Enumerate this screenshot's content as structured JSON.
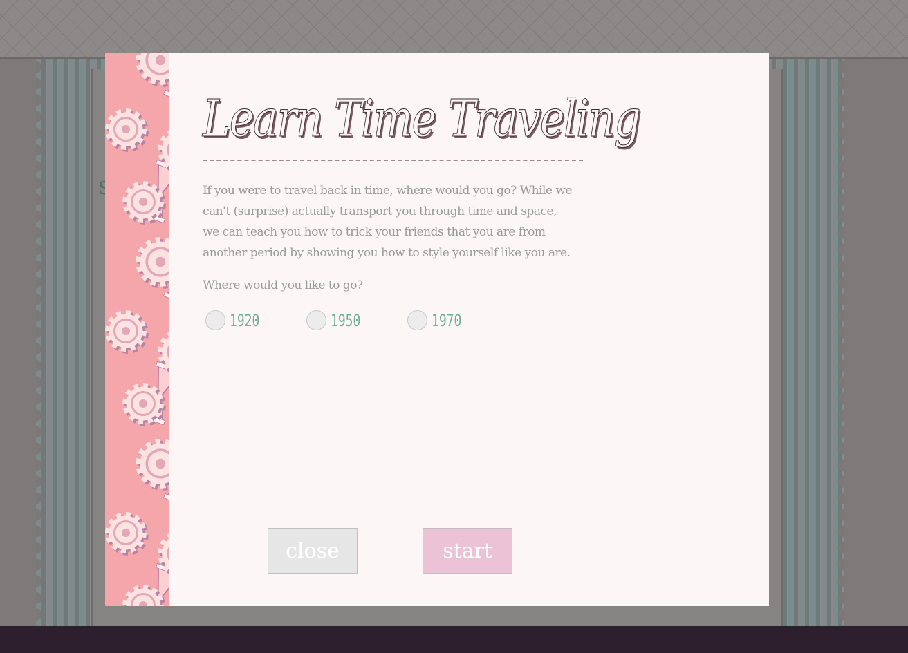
{
  "background": {
    "ghost_text": "S"
  },
  "modal": {
    "title": "Learn Time Traveling",
    "description": "If you were to travel back in time, where would you go? While we can't (surprise) actually transport you through time and space, we can teach you how to trick your friends that you are from another period by showing you how to style yourself like you are.",
    "question": "Where would you like to go?",
    "options": [
      {
        "label": "1920",
        "selected": false
      },
      {
        "label": "1950",
        "selected": false
      },
      {
        "label": "1970",
        "selected": false
      }
    ],
    "close_label": "close",
    "start_label": "start"
  },
  "colors": {
    "modal_bg": "#fdf6f7",
    "art_pink": "#f4a6ab",
    "option_text": "#6faf95",
    "start_button": "#ecc3d6",
    "close_button": "#e6e6e6",
    "bottom_bar": "#2d1f2d"
  },
  "icons": [
    "gear-icon",
    "hourglass-icon"
  ]
}
